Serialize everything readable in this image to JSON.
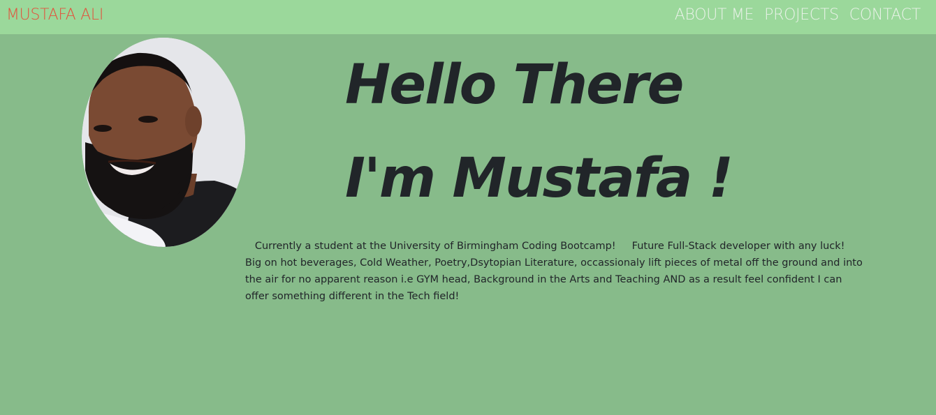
{
  "navbar": {
    "brand": "MUSTAFA ALI",
    "links": [
      "ABOUT ME",
      "PROJECTS",
      "CONTACT"
    ],
    "brand_color": "#e2523c",
    "background": "#9bd89b"
  },
  "main": {
    "background": "#87bb8a",
    "avatar_icon": "profile-photo",
    "heading_line1": "Hello There",
    "heading_line2": "I'm Mustafa !",
    "bio": "   Currently a student at the University of Birmingham Coding Bootcamp!     Future Full-Stack developer with any luck! Big on hot beverages, Cold Weather, Poetry,Dsytopian Literature, occassionaly lift pieces of metal off the ground and into the air for no apparent reason i.e GYM head, Background in the Arts and Teaching AND as a result feel confident I can offer something different in the Tech field!"
  }
}
